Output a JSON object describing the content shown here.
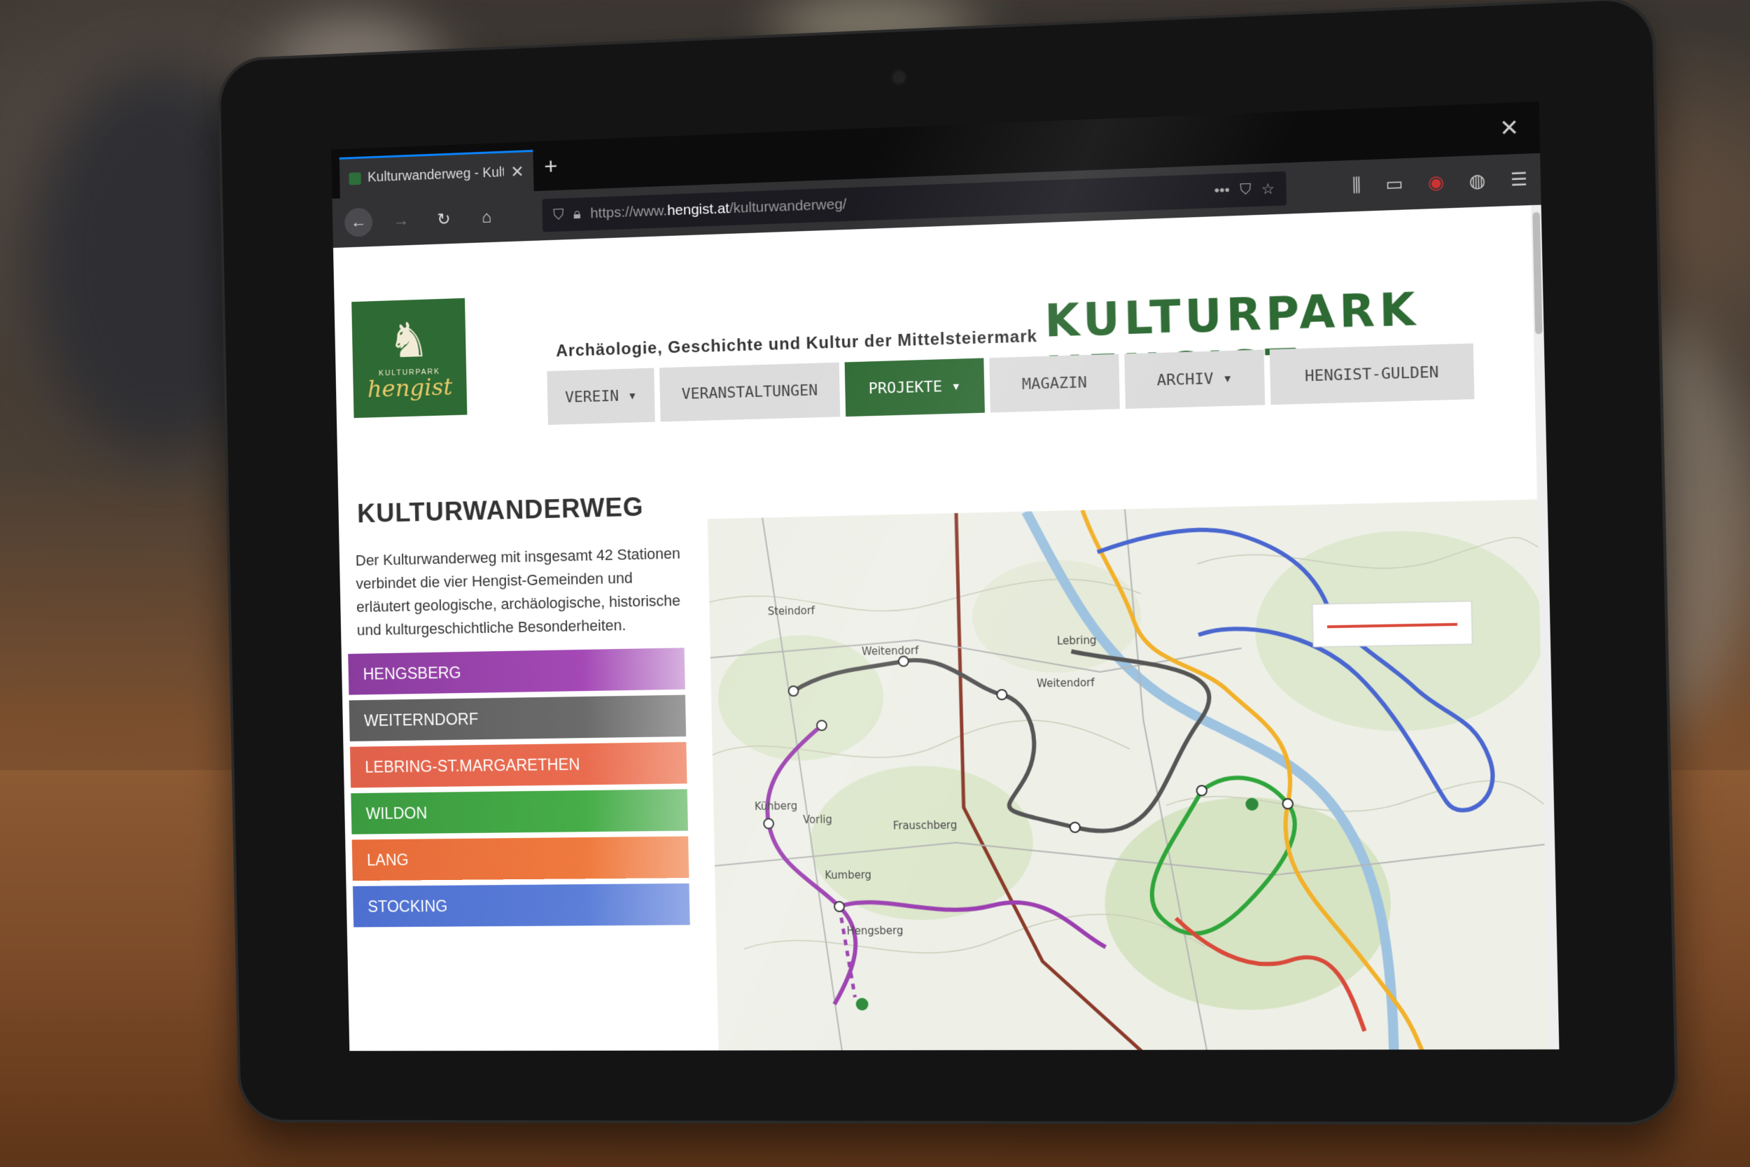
{
  "browser": {
    "tab_title": "Kulturwanderweg - Kulturpar",
    "tab_close": "✕",
    "new_tab": "+",
    "window_close": "✕",
    "url_prefix": "https://www.",
    "url_domain": "hengist.at",
    "url_path": "/kulturwanderweg/",
    "icons": {
      "back": "back-arrow-icon",
      "forward": "forward-arrow-icon",
      "reload": "reload-icon",
      "home": "home-icon",
      "shield": "shield-icon",
      "lock": "lock-icon",
      "more": "more-icon",
      "pocket": "pocket-icon",
      "bookmark": "star-icon",
      "library": "library-icon",
      "reader": "reader-view-icon",
      "addon": "addon-icon",
      "account": "account-icon",
      "menu": "hamburger-menu-icon"
    }
  },
  "header": {
    "logo_small": "KULTURPARK",
    "logo_big": "hengist",
    "tagline": "Archäologie, Geschichte und Kultur der Mittelsteiermark",
    "site_title": "KULTURPARK HENGIST"
  },
  "nav": {
    "items": [
      {
        "label": "VEREIN ▾",
        "active": false
      },
      {
        "label": "VERANSTALTUNGEN",
        "active": false
      },
      {
        "label": "PROJEKTE ▾",
        "active": true
      },
      {
        "label": "MAGAZIN",
        "active": false
      },
      {
        "label": "ARCHIV ▾",
        "active": false
      },
      {
        "label": "HENGIST-GULDEN",
        "active": false
      }
    ]
  },
  "main": {
    "title": "KULTURWANDERWEG",
    "intro": "Der Kulturwanderweg mit insgesamt 42 Stationen verbindet die vier Hengist-Gemeinden und erläutert geologische, archäologische, historische und kulturgeschichtliche Besonderheiten.",
    "routes": [
      {
        "label": "HENGSBERG",
        "color": "#a449b5"
      },
      {
        "label": "WEITERNDORF",
        "color": "#6b6b6b"
      },
      {
        "label": "LEBRING-ST.MARGARETHEN",
        "color": "#ea6c4f"
      },
      {
        "label": "WILDON",
        "color": "#46ad48"
      },
      {
        "label": "LANG",
        "color": "#ef7a3e"
      },
      {
        "label": "STOCKING",
        "color": "#5b7ed8"
      }
    ],
    "map": {
      "place_labels": [
        "Steindorf",
        "Weitendorf",
        "Kühberg",
        "Vorlig",
        "Hengsberg",
        "Kumberg",
        "Frauschberg",
        "Weitendorf",
        "Lebring"
      ],
      "colors": {
        "hengsberg": "#9b3fb0",
        "weiterndorf": "#555555",
        "lebring": "#d94a3a",
        "wildon": "#2fa53a",
        "lang": "#f2b12a",
        "stocking": "#4a66cf",
        "railway": "#8b3a2a"
      }
    }
  }
}
